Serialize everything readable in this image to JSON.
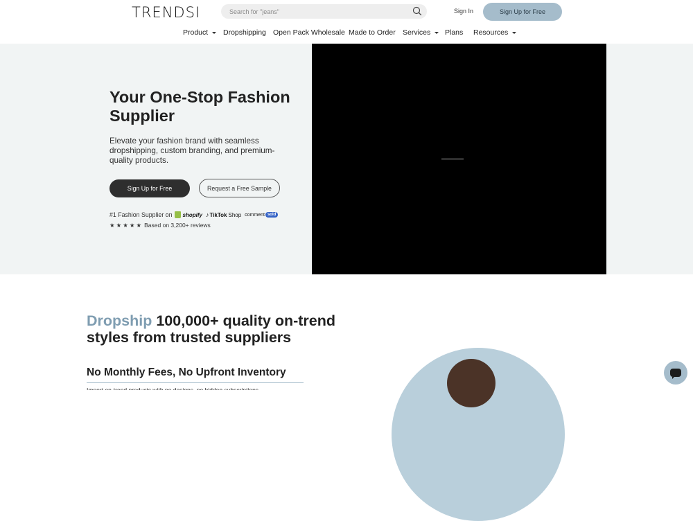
{
  "header": {
    "logo_text": "TRENDSI",
    "search_placeholder": "Search for \"jeans\"",
    "search_icon": "search-icon",
    "sign_in_label": "Sign In",
    "sign_up_label": "Sign Up for Free"
  },
  "nav": {
    "items": [
      {
        "label": "Product",
        "has_dropdown": true
      },
      {
        "label": "Dropshipping",
        "has_dropdown": false
      },
      {
        "label": "Open Pack Wholesale",
        "has_dropdown": false
      },
      {
        "label": "Made to Order",
        "has_dropdown": false
      },
      {
        "label": "Services",
        "has_dropdown": true
      },
      {
        "label": "Plans",
        "has_dropdown": false
      },
      {
        "label": "Resources",
        "has_dropdown": true
      }
    ]
  },
  "hero": {
    "title": "Your One-Stop Fashion Supplier",
    "subtitle": "Elevate your fashion brand with seamless dropshipping, custom branding, and premium-quality products.",
    "primary_button": "Sign Up for Free",
    "secondary_button": "Request a Free Sample",
    "supplier_prefix": "#1 Fashion Supplier on",
    "partners": {
      "shopify": "shopify",
      "tiktok": "TikTok",
      "tiktok_suffix": "Shop",
      "commentsold_text": "comment",
      "commentsold_badge": "sold"
    },
    "rating_stars": 5,
    "reviews_text": "Based on 3,200+ reviews"
  },
  "section2": {
    "title_accent": "Dropship",
    "title_rest": " 100,000+ quality on-trend styles from trusted suppliers",
    "feature_title": "No Monthly Fees, No Upfront Inventory",
    "feature_text": "Import on-trend products with no designs, no hidden subscriptions"
  },
  "colors": {
    "accent": "#7f9db1",
    "button_light": "#a5bccb",
    "button_dark": "#2e2e2e",
    "hero_bg": "#f1f4f4",
    "video_bg": "#000000"
  },
  "chat": {
    "icon": "chat-icon"
  }
}
